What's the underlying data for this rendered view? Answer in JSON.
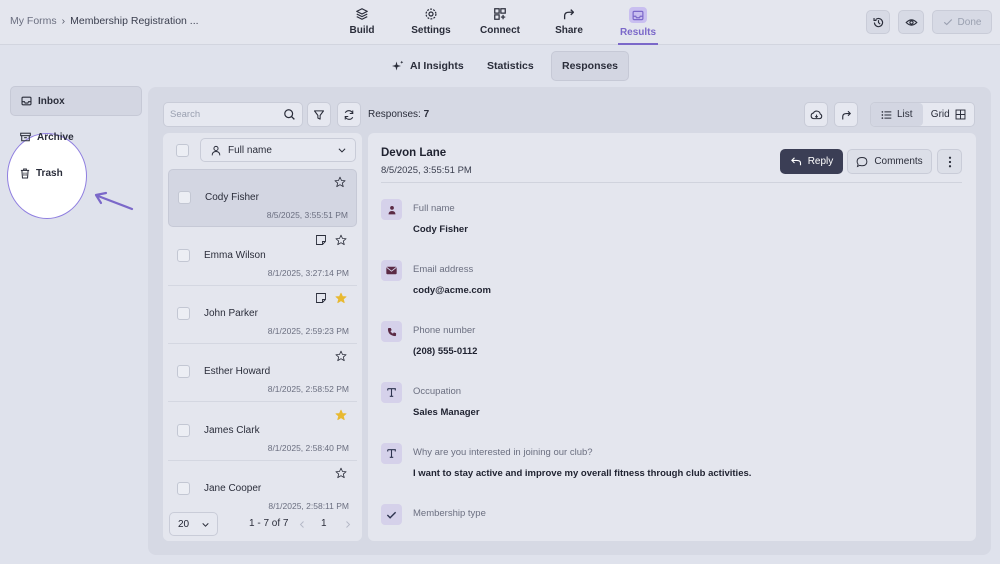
{
  "breadcrumb": {
    "root": "My Forms",
    "separator": "›",
    "current": "Membership Registration ..."
  },
  "top_nav": [
    {
      "label": "Build",
      "icon": "layers-icon"
    },
    {
      "label": "Settings",
      "icon": "gear-icon"
    },
    {
      "label": "Connect",
      "icon": "connect-icon"
    },
    {
      "label": "Share",
      "icon": "share-icon"
    },
    {
      "label": "Results",
      "icon": "inbox-icon",
      "active": true
    }
  ],
  "top_actions": {
    "history": "history-icon",
    "preview": "eye-icon",
    "done_label": "Done"
  },
  "sub_tabs": [
    {
      "label": "AI Insights",
      "icon": "sparkle-icon"
    },
    {
      "label": "Statistics"
    },
    {
      "label": "Responses",
      "active": true
    }
  ],
  "sidebar": [
    {
      "label": "Inbox",
      "icon": "inbox-icon",
      "active": true
    },
    {
      "label": "Archive",
      "icon": "archive-icon"
    },
    {
      "label": "Trash",
      "icon": "trash-icon"
    }
  ],
  "toolbar": {
    "search_placeholder": "Search",
    "responses_label": "Responses:",
    "responses_count": "7",
    "view_list": "List",
    "view_grid": "Grid"
  },
  "list": {
    "sort_field": "Full name",
    "items": [
      {
        "name": "Cody Fisher",
        "date": "8/5/2025, 3:55:51 PM",
        "starred": false,
        "note": false,
        "selected": true
      },
      {
        "name": "Emma Wilson",
        "date": "8/1/2025, 3:27:14 PM",
        "starred": false,
        "note": true
      },
      {
        "name": "John Parker",
        "date": "8/1/2025, 2:59:23 PM",
        "starred": true,
        "note": true
      },
      {
        "name": "Esther Howard",
        "date": "8/1/2025, 2:58:52 PM",
        "starred": false,
        "note": false
      },
      {
        "name": "James Clark",
        "date": "8/1/2025, 2:58:40 PM",
        "starred": true,
        "note": false
      },
      {
        "name": "Jane Cooper",
        "date": "8/1/2025, 2:58:11 PM",
        "starred": false,
        "note": false
      }
    ],
    "page_size": "20",
    "page_range": "1 - 7 of 7",
    "page_number": "1"
  },
  "detail": {
    "name": "Devon Lane",
    "date": "8/5/2025, 3:55:51 PM",
    "reply_label": "Reply",
    "comments_label": "Comments",
    "fields": [
      {
        "label": "Full name",
        "value": "Cody Fisher",
        "icon": "person-icon"
      },
      {
        "label": "Email address",
        "value": "cody@acme.com",
        "icon": "mail-icon"
      },
      {
        "label": "Phone number",
        "value": "(208) 555-0112",
        "icon": "phone-icon"
      },
      {
        "label": "Occupation",
        "value": "Sales Manager",
        "icon": "text-icon"
      },
      {
        "label": "Why are you interested in joining our club?",
        "value": "I want to stay active and improve my overall fitness through club activities.",
        "icon": "text-icon"
      },
      {
        "label": "Membership type",
        "value": "",
        "icon": "check-icon"
      }
    ]
  },
  "colors": {
    "accent": "#7b68c9",
    "star": "#e8b931",
    "reply_bg": "#3b3e55"
  }
}
